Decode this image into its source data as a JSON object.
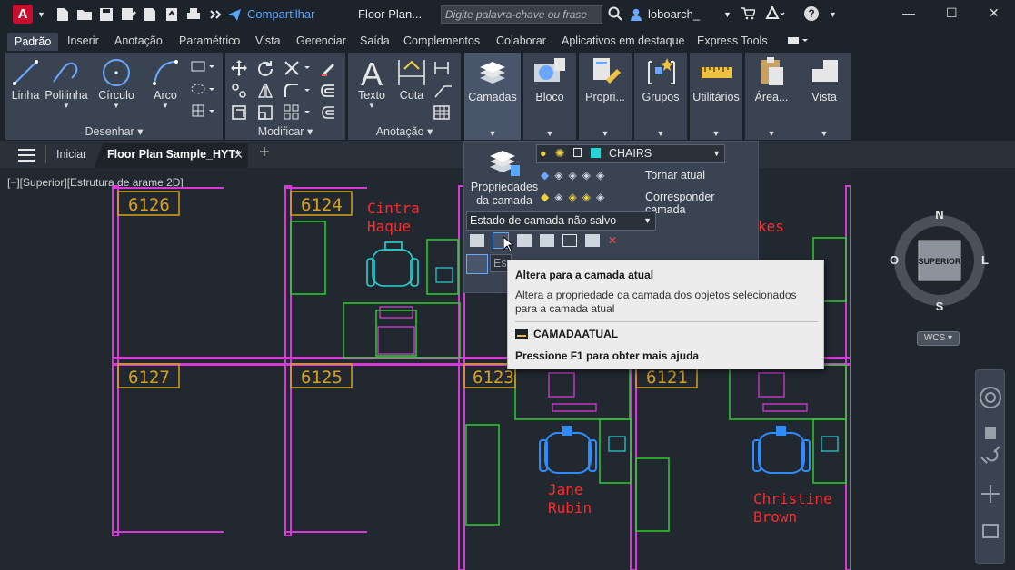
{
  "app": {
    "logo_letter": "A",
    "share_label": "Compartilhar",
    "doc_title": "Floor Plan...",
    "search_placeholder": "Digite palavra-chave ou frase",
    "user": "loboarch_"
  },
  "ribbon_tabs": [
    "Padrão",
    "Inserir",
    "Anotação",
    "Paramétrico",
    "Vista",
    "Gerenciar",
    "Saída",
    "Complementos",
    "Colaborar",
    "Aplicativos em destaque",
    "Express Tools"
  ],
  "panels": {
    "draw": {
      "title": "Desenhar",
      "tools": [
        "Linha",
        "Polilinha",
        "Círculo",
        "Arco"
      ]
    },
    "modify": {
      "title": "Modificar"
    },
    "annotation": {
      "title": "Anotação",
      "tools": [
        "Texto",
        "Cota"
      ]
    },
    "big_buttons": [
      "Camadas",
      "Bloco",
      "Propri...",
      "Grupos",
      "Utilitários",
      "Área...",
      "Vista"
    ]
  },
  "file_tabs": {
    "home": "Iniciar",
    "active": "Floor Plan Sample_HYT*"
  },
  "viewport_label": "[−][Superior][Estrutura de arame 2D]",
  "layers_panel": {
    "props_label": "Propriedades da camada",
    "current_layer": "CHAIRS",
    "make_current": "Tornar atual",
    "match_layer": "Corresponder camada",
    "layer_state": "Estado de camada não salvo",
    "partial_input": "Es"
  },
  "tooltip": {
    "title": "Altera para a camada atual",
    "description": "Altera a propriedade da camada dos objetos selecionados para a camada atual",
    "command": "CAMADAATUAL",
    "help": "Pressione F1 para obter mais ajuda"
  },
  "rooms": [
    "6126",
    "6124",
    "6127",
    "6125",
    "6123",
    "6121"
  ],
  "names": [
    "Cintra",
    "Haque",
    "Jane",
    "Rubin",
    "Christine",
    "Brown",
    "kes"
  ],
  "viewcube": {
    "n": "N",
    "s": "S",
    "e": "L",
    "w": "O",
    "face": "SUPERIOR",
    "wcs": "WCS"
  },
  "colors": {
    "accent": "#5aa7ff",
    "walls": "#d63ad6",
    "room_tag": "#d8a11c",
    "furniture": "#2ad02a",
    "chairs": "#2ad3d3",
    "names": "#ff2b2b",
    "selected_chair": "#2f8cff"
  }
}
